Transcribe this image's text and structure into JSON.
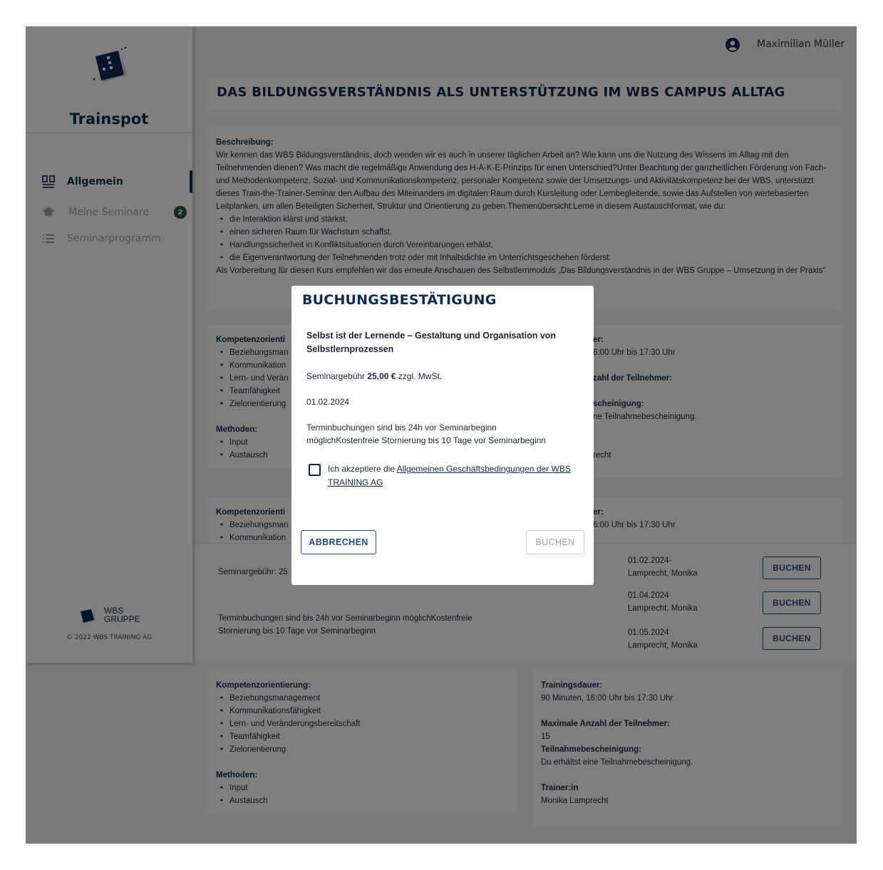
{
  "sidebar": {
    "brand": "Trainspot",
    "items": [
      {
        "label": "Allgemein"
      },
      {
        "label": "Meine Seminare",
        "badge": "2"
      },
      {
        "label": "Seminarprogramm"
      }
    ],
    "footer_logo_line1": "WBS",
    "footer_logo_line2": "GRUPPE",
    "copyright": "© 2022 WBS TRAINING AG"
  },
  "header": {
    "user_name": "Maximilian Müller"
  },
  "page": {
    "title": "DAS BILDUNGSVERSTÄNDNIS ALS UNTERSTÜTZUNG IM WBS CAMPUS ALLTAG",
    "description_label": "Beschreibung:",
    "description_text": "Wir kennen das WBS Bildungsverständnis, doch wenden wir es auch in unserer täglichen Arbeit an? Wie kann uns die Nutzung des Wissens im Alltag mit den Teilnehmenden dienen? Was macht die regelmäßige Anwendung des H-A-K-E-Prinzips für einen Unterschied?Unter Beachtung der ganzheitlichen Förderung von Fach- und Methodenkompetenz, Sozial- und Kommunikationskompetenz, personaler Kompetenz sowie der Umsetzungs- und Aktivitätskompetenz bei der WBS, unterstützt dieses Train-the-Trainer-Seminar den Aufbau des Miteinanders im digitalen Raum durch Kursleitung oder Lernbegleitende, sowie das Aufstellen von wertebasierten Leitplanken, um allen Beteiligten Sicherheit, Struktur und Orientierung zu geben.Themenübersicht:Lerne in diesem Austauschformat, wie du:",
    "topics": [
      "die Interaktion klärst und stärkst,",
      "einen sicheren Raum für Wachstum schaffst,",
      "Handlungssicherheit in Konfliktsituationen durch Vereinbarungen erhälst,",
      "die Eigenverantwortung der Teilnehmenden trotz oder mit Inhaltsdichte im Unterrichtsgeschehen förderst."
    ],
    "description_footer": "Als Vorbereitung für diesen Kurs empfehlen wir das erneute Anschauen des Selbstlernmoduls „Das Bildungsverständnis in der WBS Gruppe – Umsetzung in der Praxis“"
  },
  "seminar_blocks": {
    "competence_label": "Kompetenzorientierung:",
    "competences": [
      "Beziehungsmanagement",
      "Kommunikationsfähigkeit",
      "Lern- und Veränderungsbereitschaft",
      "Teamfähigkeit",
      "Zielorientierung"
    ],
    "methods_label": "Methoden:",
    "methods": [
      "Input",
      "Austausch"
    ],
    "duration_label": "Trainingsdauer:",
    "duration": "90 Minuten, 16:00 Uhr bis 17:30 Uhr",
    "max_label": "Maximale Anzahl der Teilnehmer:",
    "max": "15",
    "cert_label": "Teilnahmebescheinigung:",
    "cert": "Du erhältst eine Teilnahmebescheinigung.",
    "trainer_label": "Trainer:in",
    "trainer": "Monika Lamprecht",
    "partial": {
      "comp_label": "Kompetenzorienti",
      "comp": [
        "Beziehungsman",
        "Kommunikation",
        "Lern- und Verän",
        "Teamfähigkeit",
        "Zielorientierung"
      ],
      "right_duration_label": "er:",
      "right_duration": "6:00 Uhr bis 17:30 Uhr",
      "right_max_label": "zahl der Teilnehmer:",
      "right_cert_label": "scheinigung:",
      "right_cert": "ne Teilnahmebescheinigung.",
      "right_trainer": "recht",
      "comp2": [
        "Beziehungsman",
        "Kommunikation"
      ]
    }
  },
  "booking": {
    "fee_partial": "Seminargebühr: 25",
    "terms": "Terminbuchungen sind bis 24h vor Seminarbeginn möglichKostenfreie Stornierung bis 10 Tage vor Seminarbeginn",
    "slots": [
      {
        "date": "01.02.2024-",
        "trainer": "Lamprecht, Monika",
        "button": "BUCHEN"
      },
      {
        "date": "01.04.2024",
        "trainer": "Lamprecht, Monika",
        "button": "BUCHEN"
      },
      {
        "date": "01.05.2024",
        "trainer": "Lamprecht, Monika",
        "button": "BUCHEN"
      }
    ]
  },
  "modal": {
    "title": "BUCHUNGSBESTÄTIGUNG",
    "seminar": "Selbst ist der Lernende – Gestaltung und Organisation von Selbstlernprozessen",
    "fee_prefix": "Seminargebühr ",
    "fee_amount": "25,00 €",
    "fee_suffix": " zzgl. MwSt.",
    "date": "01.02.2024",
    "terms": "Terminbuchungen sind bis 24h vor Seminarbeginn möglichKostenfreie Stornierung bis 10 Tage vor Seminarbeginn",
    "agb_prefix": "Ich akzeptiere die ",
    "agb_link": "Allgemeinen Geschäftsbedingungen der WBS TRAINING AG",
    "agb_checked": false,
    "cancel_label": "ABBRECHEN",
    "book_label": "BUCHEN"
  },
  "colors": {
    "brand": "#0d2b52",
    "accent": "#1a4e88",
    "badge": "#1f5b2c",
    "overlay": "rgba(0,0,0,0.5)"
  }
}
